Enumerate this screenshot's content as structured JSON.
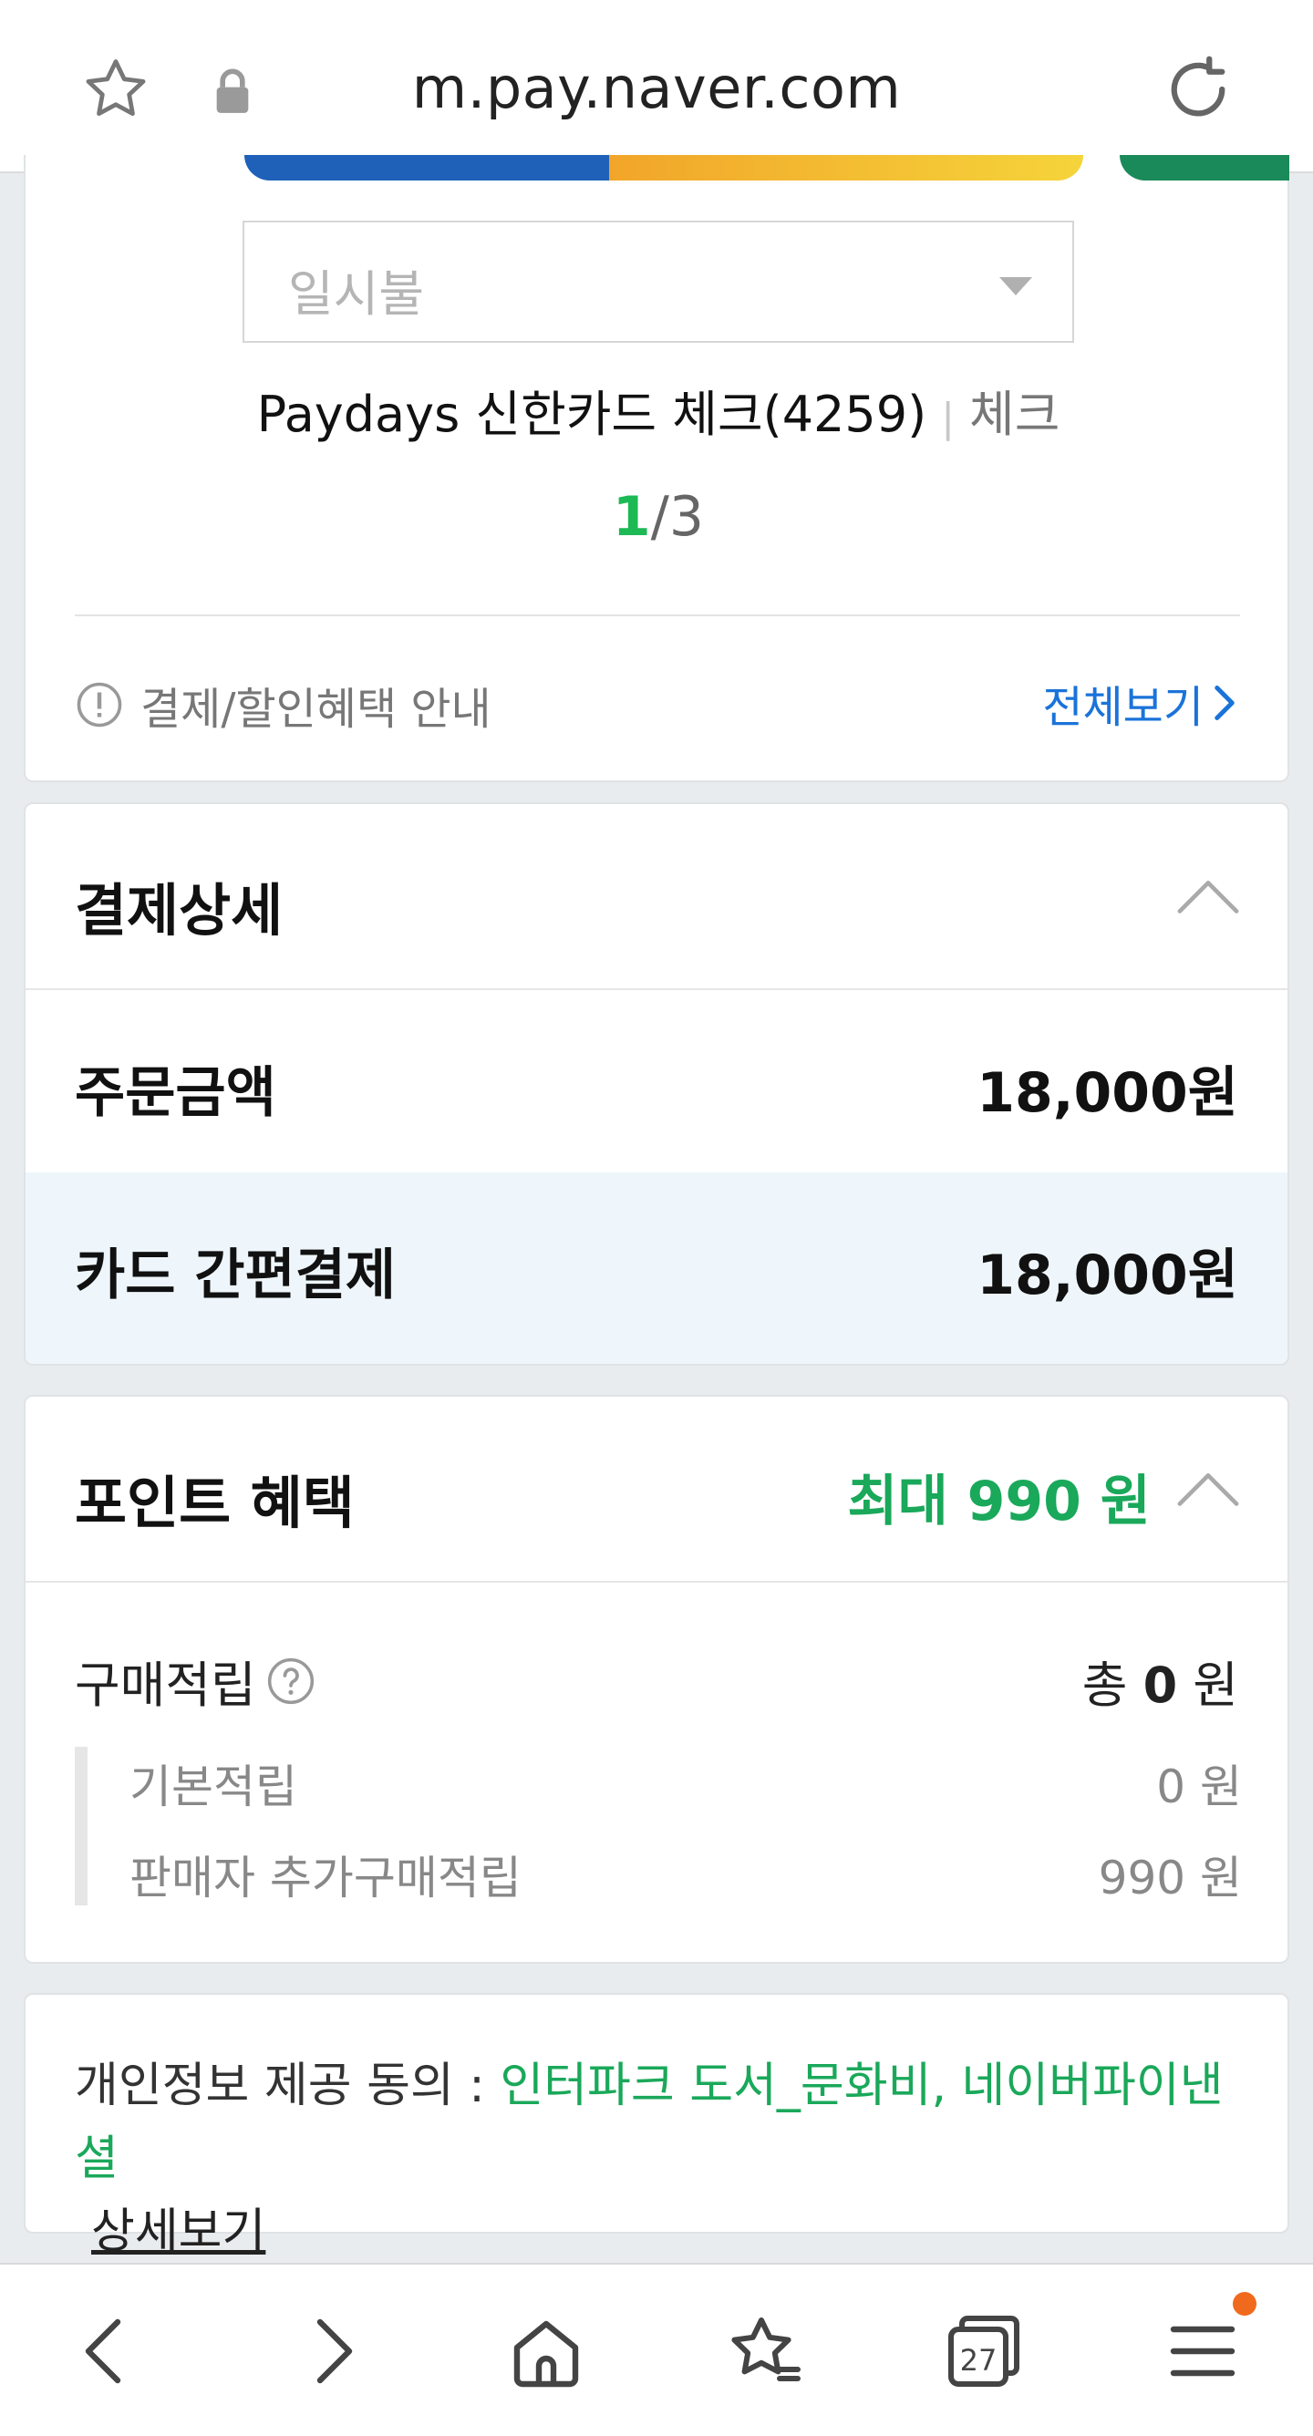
{
  "browser": {
    "url": "m.pay.naver.com",
    "tab_count": "27"
  },
  "payment_card": {
    "installment_value": "일시불",
    "card_name": "Paydays 신한카드 체크(4259)",
    "card_separator": "|",
    "card_type": "체크",
    "pager_current": "1",
    "pager_total": "/3",
    "notice_text": "결제/할인혜택 안내",
    "view_all_label": "전체보기"
  },
  "payment_detail": {
    "title": "결제상세",
    "order_label": "주문금액",
    "order_amount": "18,000원",
    "card_pay_label": "카드 간편결제",
    "card_pay_amount": "18,000원"
  },
  "points": {
    "title": "포인트 혜택",
    "max_label": "최대 990 원",
    "purchase_label": "구매적립",
    "purchase_total_prefix": "총 ",
    "purchase_total_value": "0",
    "purchase_total_suffix": " 원",
    "basic_label": "기본적립",
    "basic_value": "0 원",
    "seller_label": "판매자 추가구매적립",
    "seller_value": "990 원"
  },
  "consent": {
    "prefix": "개인정보 제공 동의 : ",
    "parties": "인터파크 도서_문화비, 네이버파이낸셜",
    "detail_link": "상세보기"
  },
  "colors": {
    "accent_green": "#1aa85a",
    "link_blue": "#1a73d9",
    "badge_orange": "#f06a1d"
  }
}
